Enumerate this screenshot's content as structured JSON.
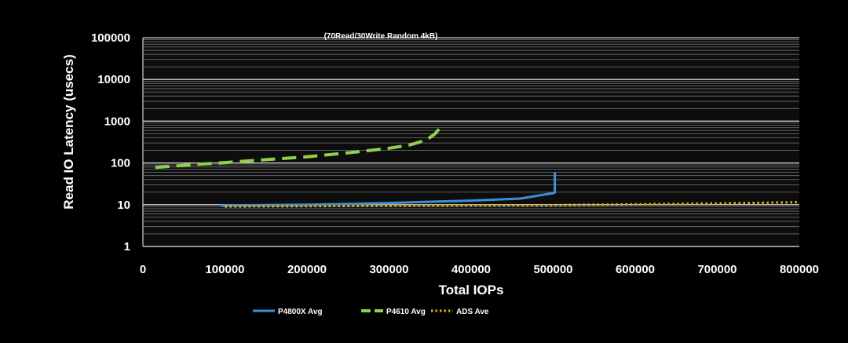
{
  "chart_data": {
    "type": "line",
    "title": "(70Read/30Write Random 4kB)",
    "xlabel": "Total IOPs",
    "ylabel": "Read IO Latency (usecs)",
    "y_scale": "log",
    "xlim": [
      0,
      800000
    ],
    "ylim": [
      1,
      100000
    ],
    "x_ticks": [
      "0",
      "100000",
      "200000",
      "300000",
      "400000",
      "500000",
      "600000",
      "700000",
      "800000"
    ],
    "y_ticks": [
      "1",
      "10",
      "100",
      "1000",
      "10000",
      "100000"
    ],
    "grid": true,
    "legend_position": "bottom",
    "series": [
      {
        "name": "P4800X Avg",
        "color": "#3d8fd6",
        "style": "solid",
        "x": [
          95000,
          150000,
          200000,
          250000,
          300000,
          350000,
          400000,
          460000,
          500000,
          502000,
          502000
        ],
        "y": [
          9.5,
          9.8,
          10,
          10.4,
          11,
          11.8,
          12.5,
          14,
          19,
          19.5,
          60
        ]
      },
      {
        "name": "P4610 Avg",
        "color": "#8fd24a",
        "style": "dashed",
        "x": [
          15000,
          50000,
          100000,
          150000,
          200000,
          250000,
          300000,
          325000,
          345000,
          355000,
          362000
        ],
        "y": [
          78,
          88,
          102,
          120,
          140,
          175,
          225,
          270,
          350,
          480,
          680
        ]
      },
      {
        "name": "ADS Ave",
        "color": "#e8b200",
        "style": "dotted",
        "x": [
          100000,
          200000,
          300000,
          400000,
          500000,
          600000,
          700000,
          800000
        ],
        "y": [
          9,
          9.2,
          9.4,
          9.6,
          9.8,
          10.2,
          10.7,
          11.5
        ]
      }
    ]
  }
}
